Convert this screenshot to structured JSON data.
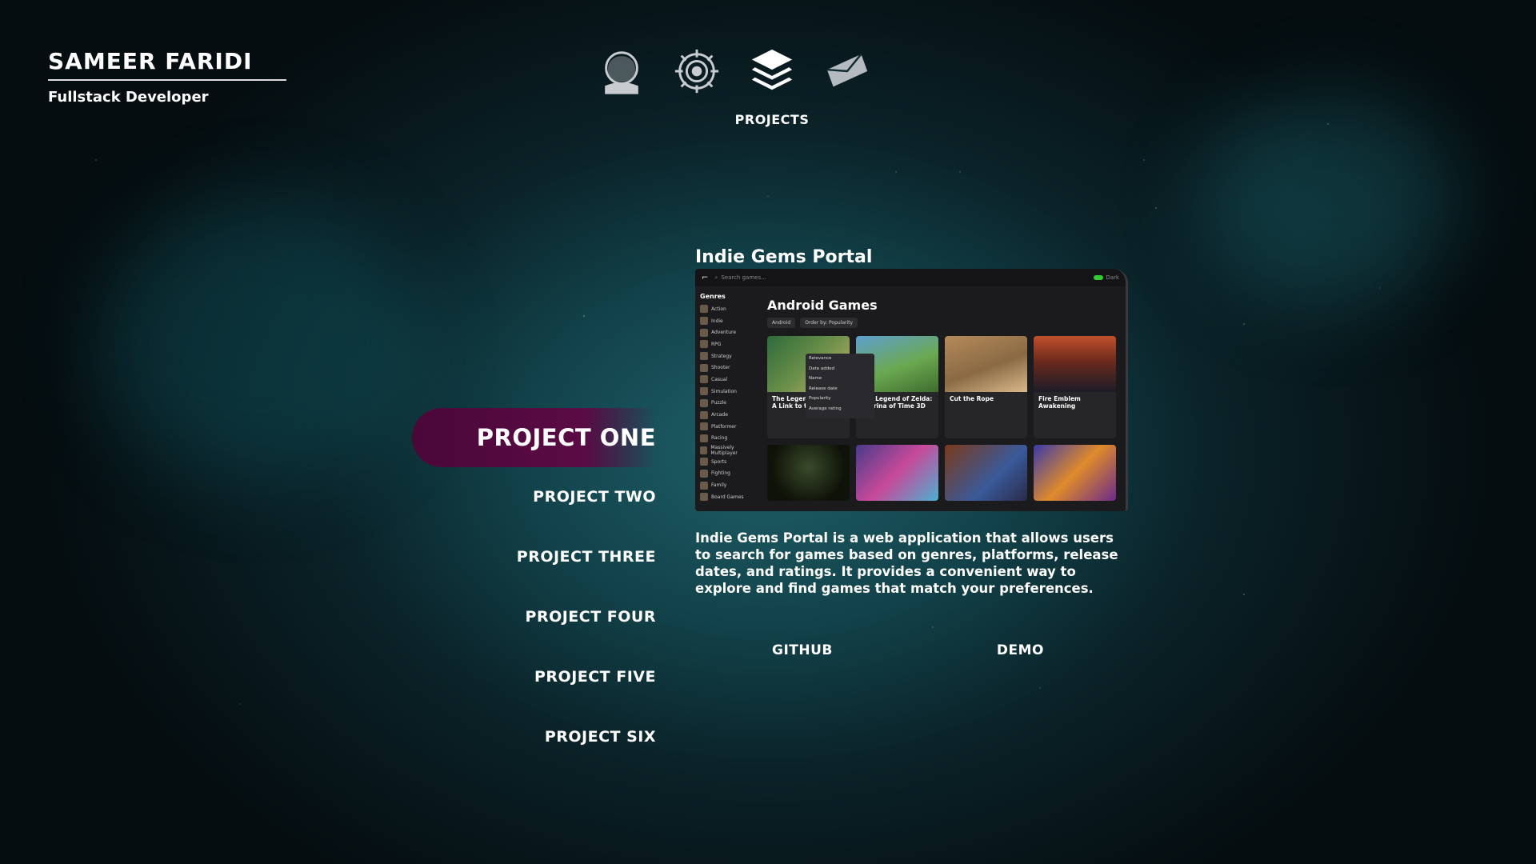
{
  "brand": {
    "name": "SAMEER FARIDI",
    "subtitle": "Fullstack Developer"
  },
  "nav": {
    "items": [
      {
        "icon": "astronaut-helmet-icon",
        "label": ""
      },
      {
        "icon": "target-icon",
        "label": ""
      },
      {
        "icon": "layers-icon",
        "label": "PROJECTS"
      },
      {
        "icon": "envelope-icon",
        "label": ""
      }
    ],
    "active_label": "PROJECTS"
  },
  "projects": [
    "PROJECT ONE",
    "PROJECT TWO",
    "PROJECT THREE",
    "PROJECT FOUR",
    "PROJECT FIVE",
    "PROJECT SIX"
  ],
  "active_project": {
    "title": "Indie Gems Portal",
    "description": "Indie Gems Portal is a web application that allows users to search for games based on genres, platforms, release dates, and ratings. It provides a convenient way to explore and find games that match your preferences.",
    "links": {
      "github": "GITHUB",
      "demo": "DEMO"
    },
    "screenshot": {
      "search_placeholder": "Search games...",
      "toggle_label": "Dark",
      "heading": "Android Games",
      "genres_heading": "Genres",
      "genres": [
        "Action",
        "Indie",
        "Adventure",
        "RPG",
        "Strategy",
        "Shooter",
        "Casual",
        "Simulation",
        "Puzzle",
        "Arcade",
        "Platformer",
        "Racing",
        "Massively Multiplayer",
        "Sports",
        "Fighting",
        "Family",
        "Board Games"
      ],
      "filter_platform": "Android",
      "filter_order": "Order by: Popularity",
      "order_options": [
        "Relevance",
        "Date added",
        "Name",
        "Release date",
        "Popularity",
        "Average rating"
      ],
      "games": [
        "The Legend of Zelda: A Link to the Past",
        "The Legend of Zelda: Ocarina of Time 3D",
        "Cut the Rope",
        "Fire Emblem Awakening"
      ]
    }
  },
  "colors": {
    "active_pill": "#5a0a44",
    "background": "#124149"
  }
}
